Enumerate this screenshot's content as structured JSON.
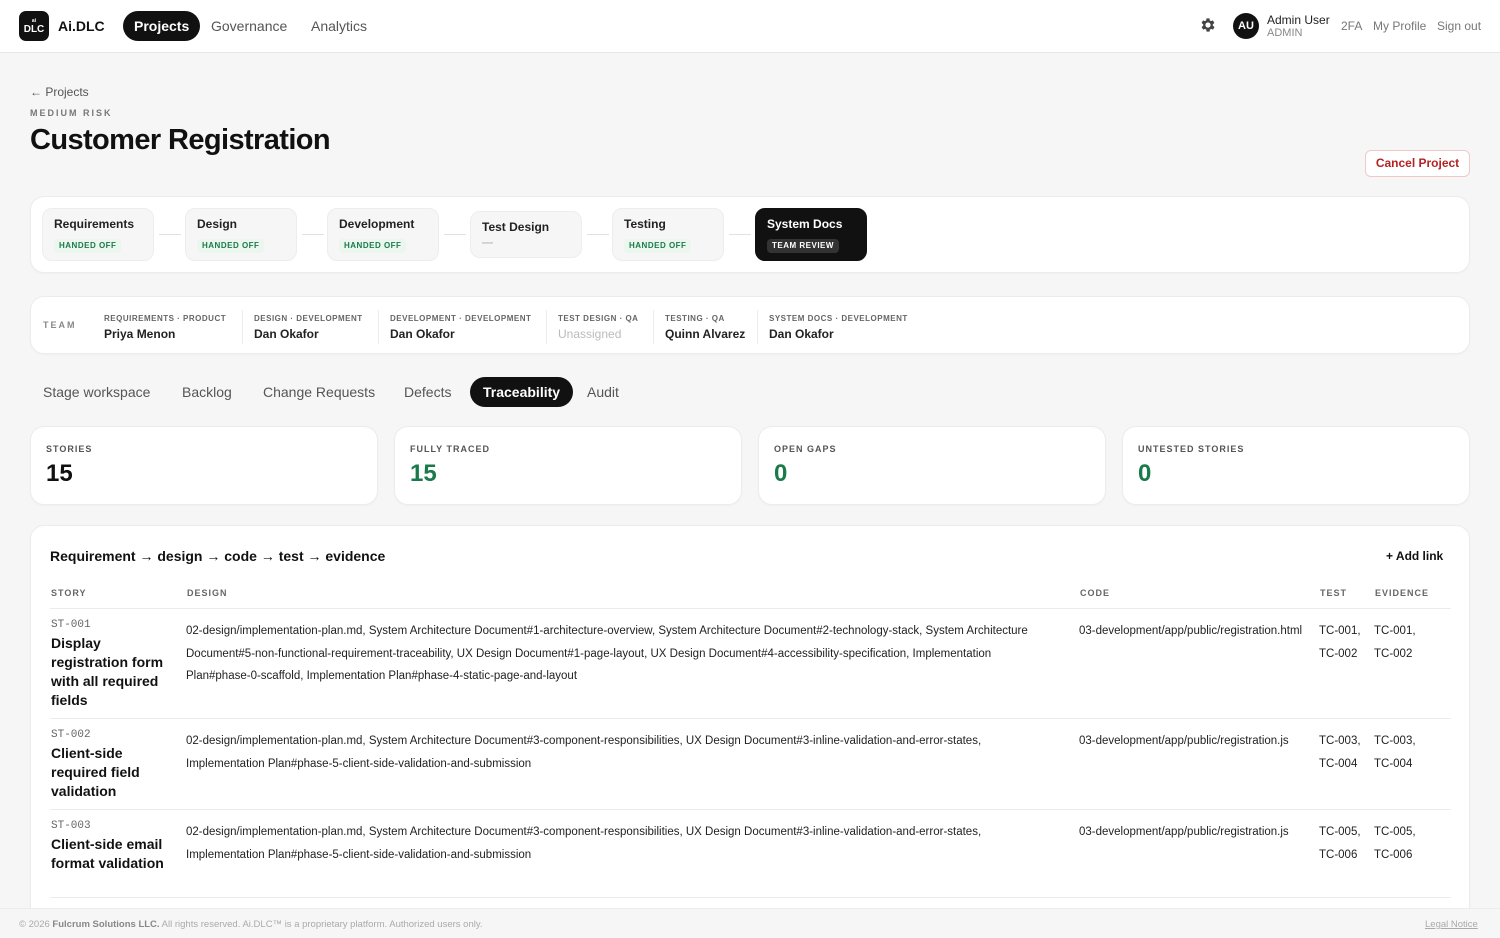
{
  "topnav": {
    "logo_top": "ai",
    "logo_main": "DLC",
    "brand": "Ai.DLC",
    "items": [
      "Projects",
      "Governance",
      "Analytics"
    ],
    "user": {
      "initials": "AU",
      "name": "Admin User",
      "role": "ADMIN"
    },
    "links": [
      "2FA",
      "My Profile",
      "Sign out"
    ]
  },
  "header": {
    "back": "← Projects",
    "risk": "MEDIUM RISK",
    "title": "Customer Registration",
    "cancel": "Cancel Project"
  },
  "stages": [
    {
      "name": "Requirements",
      "status": "HANDED OFF"
    },
    {
      "name": "Design",
      "status": "HANDED OFF"
    },
    {
      "name": "Development",
      "status": "HANDED OFF"
    },
    {
      "name": "Test Design",
      "status": "—"
    },
    {
      "name": "Testing",
      "status": "HANDED OFF"
    },
    {
      "name": "System Docs",
      "status": "TEAM REVIEW"
    }
  ],
  "team": {
    "label": "TEAM",
    "members": [
      {
        "role": "REQUIREMENTS · PRODUCT",
        "person": "Priya Menon"
      },
      {
        "role": "DESIGN · DEVELOPMENT",
        "person": "Dan Okafor"
      },
      {
        "role": "DEVELOPMENT · DEVELOPMENT",
        "person": "Dan Okafor"
      },
      {
        "role": "TEST DESIGN · QA",
        "person": "Unassigned"
      },
      {
        "role": "TESTING · QA",
        "person": "Quinn Alvarez"
      },
      {
        "role": "SYSTEM DOCS · DEVELOPMENT",
        "person": "Dan Okafor"
      }
    ]
  },
  "tabs": [
    "Stage workspace",
    "Backlog",
    "Change Requests",
    "Defects",
    "Traceability",
    "Audit"
  ],
  "stats": [
    {
      "label": "STORIES",
      "value": "15"
    },
    {
      "label": "FULLY TRACED",
      "value": "15"
    },
    {
      "label": "OPEN GAPS",
      "value": "0"
    },
    {
      "label": "UNTESTED STORIES",
      "value": "0"
    }
  ],
  "trace": {
    "title": "Requirement → design → code → test → evidence",
    "add_link": "+ Add link",
    "columns": [
      "STORY",
      "DESIGN",
      "CODE",
      "TEST",
      "EVIDENCE"
    ],
    "rows": [
      {
        "id": "ST-001",
        "title": "Display registration form with all required fields",
        "design": "02-design/implementation-plan.md, System Architecture Document#1-architecture-overview, System Architecture Document#2-technology-stack, System Architecture Document#5-non-functional-requirement-traceability, UX Design Document#1-page-layout, UX Design Document#4-accessibility-specification, Implementation Plan#phase-0-scaffold, Implementation Plan#phase-4-static-page-and-layout",
        "code": "03-development/app/public/registration.html",
        "test": "TC-001, TC-002",
        "evidence": "TC-001, TC-002"
      },
      {
        "id": "ST-002",
        "title": "Client-side required field validation",
        "design": "02-design/implementation-plan.md, System Architecture Document#3-component-responsibilities, UX Design Document#3-inline-validation-and-error-states, Implementation Plan#phase-5-client-side-validation-and-submission",
        "code": "03-development/app/public/registration.js",
        "test": "TC-003, TC-004",
        "evidence": "TC-003, TC-004"
      },
      {
        "id": "ST-003",
        "title": "Client-side email format validation",
        "design": "02-design/implementation-plan.md, System Architecture Document#3-component-responsibilities, UX Design Document#3-inline-validation-and-error-states, Implementation Plan#phase-5-client-side-validation-and-submission",
        "code": "03-development/app/public/registration.js",
        "test": "TC-005, TC-006",
        "evidence": "TC-005, TC-006"
      }
    ]
  },
  "footer": {
    "prefix": "© 2026 ",
    "company": "Fulcrum Solutions LLC.",
    "suffix": " All rights reserved. Ai.DLC™ is a proprietary platform. Authorized users only.",
    "legal": "Legal Notice"
  }
}
